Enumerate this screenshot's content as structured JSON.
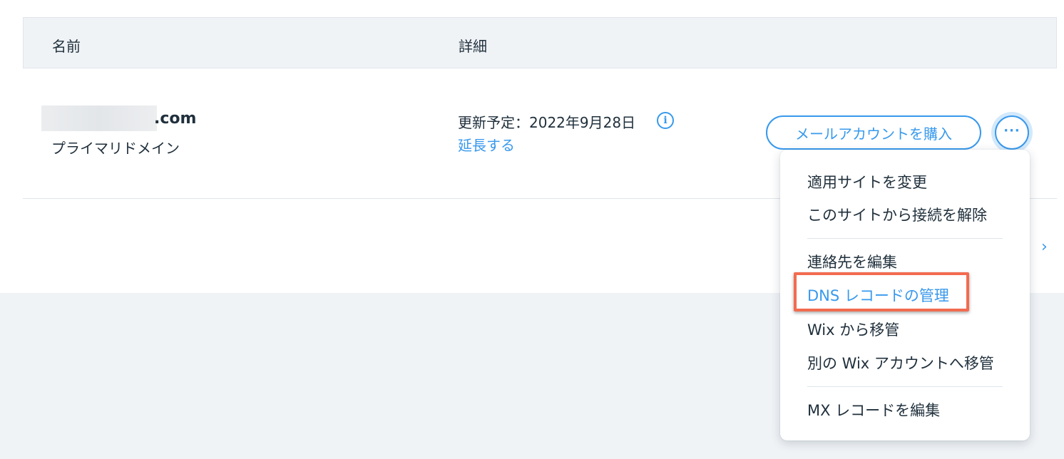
{
  "table": {
    "headers": {
      "name": "名前",
      "details": "詳細"
    }
  },
  "domain": {
    "name_suffix": ".com",
    "type": "プライマリドメイン",
    "renewal": "更新予定：2022年9月28日",
    "info_icon": "info-icon",
    "extend_link": "延長する"
  },
  "actions": {
    "buy_mail": "メールアカウントを購入",
    "more": "···"
  },
  "pagination": {
    "next": "›"
  },
  "menu": {
    "items": [
      {
        "label": "適用サイトを変更"
      },
      {
        "label": "このサイトから接続を解除"
      },
      {
        "label": "連絡先を編集"
      },
      {
        "label": "DNS レコードの管理",
        "active": true
      },
      {
        "label": "Wix から移管"
      },
      {
        "label": "別の Wix アカウントへ移管"
      },
      {
        "label": "MX レコードを編集"
      }
    ]
  },
  "colors": {
    "accent": "#3899ec",
    "highlight": "#f26b50",
    "text": "#20303c",
    "header_bg": "#f0f3f6"
  }
}
